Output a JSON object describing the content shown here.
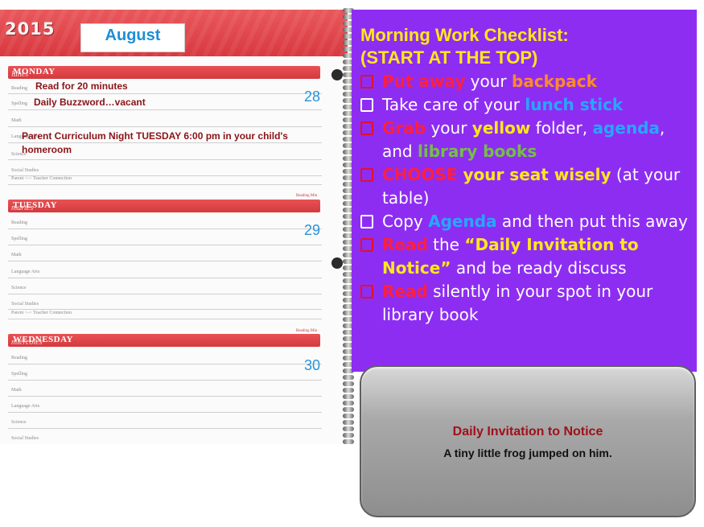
{
  "planner": {
    "year": "2015",
    "month": "August",
    "days": [
      {
        "name": "MONDAY",
        "spanish": "lunes",
        "number": "28",
        "rows": [
          "Reading",
          "Spelling",
          "Math",
          "Language Arts",
          "Science",
          "Social Studies",
          "Parent <-> Teacher Connection"
        ],
        "writing": [
          "Read for 20 minutes",
          "Daily Buzzword…vacant",
          "Parent Curriculum Night TUESDAY 6:00 pm in your child's homeroom"
        ]
      },
      {
        "name": "TUESDAY",
        "spanish": "martes",
        "number": "29",
        "rows": [
          "Reading",
          "Spelling",
          "Math",
          "Language Arts",
          "Science",
          "Social Studies",
          "Parent <-> Teacher Connection"
        ]
      },
      {
        "name": "WEDNESDAY",
        "spanish": "miércoles",
        "number": "30",
        "rows": [
          "Reading",
          "Spelling",
          "Math",
          "Language Arts",
          "Science",
          "Social Studies"
        ]
      }
    ],
    "reading_min_label": "Reading Min",
    "initials_label": "Initials"
  },
  "checklist": {
    "title_line1": "Morning Work Checklist:",
    "title_line2": "(START AT THE TOP)",
    "items": {
      "i1": {
        "a": "Put away",
        "b": " your ",
        "c": "backpack"
      },
      "i2": {
        "a": "Take care of your ",
        "b": "lunch stick"
      },
      "i3": {
        "a": "Grab",
        "b": " your ",
        "c": "yellow",
        "d": " folder, ",
        "e": "agenda",
        "f": ", and ",
        "g": "library books"
      },
      "i4": {
        "a": "CHOOSE",
        "b": " your seat wisely",
        "c": " (at your table)"
      },
      "i5": {
        "a": "Copy ",
        "b": "Agenda",
        "c": " and then put this away"
      },
      "i6": {
        "a": "Read",
        "b": " the ",
        "c": "“Daily Invitation to Notice”",
        "d": " and be ready discuss"
      },
      "i7": {
        "a": "Read",
        "b": " silently in your spot in your library book"
      }
    }
  },
  "notice": {
    "title": "Daily Invitation to Notice",
    "text": "A tiny little frog jumped on him."
  },
  "colors": {
    "panel": "#8e2df2",
    "title_yellow": "#ffe81a",
    "accent_red": "#ff1f3d",
    "accent_orange": "#ff8a2a",
    "accent_blue": "#26a8ff",
    "accent_green": "#74c043",
    "planner_red": "#d8393f"
  }
}
